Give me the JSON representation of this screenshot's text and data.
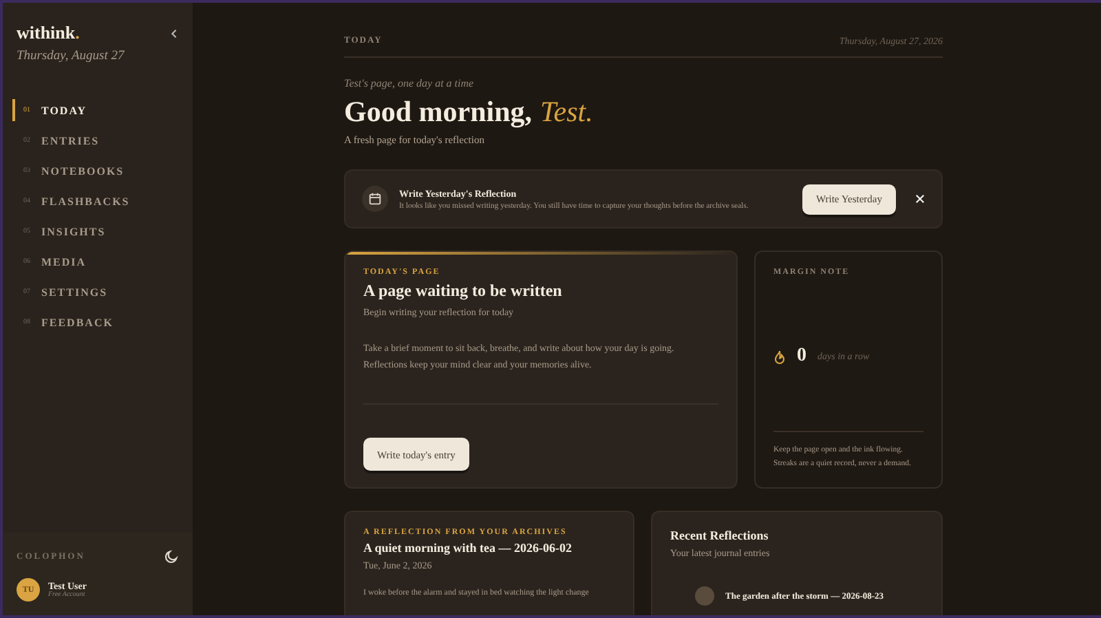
{
  "sidebar": {
    "logo": "withink",
    "logo_dot": ".",
    "date": "Thursday, August 27",
    "nav": [
      {
        "number": "01",
        "label": "TODAY",
        "selected": true
      },
      {
        "number": "02",
        "label": "ENTRIES",
        "selected": false
      },
      {
        "number": "03",
        "label": "NOTEBOOKS",
        "selected": false
      },
      {
        "number": "04",
        "label": "FLASHBACKS",
        "selected": false
      },
      {
        "number": "05",
        "label": "INSIGHTS",
        "selected": false
      },
      {
        "number": "06",
        "label": "MEDIA",
        "selected": false
      },
      {
        "number": "07",
        "label": "SETTINGS",
        "selected": false
      },
      {
        "number": "08",
        "label": "FEEDBACK",
        "selected": false
      }
    ],
    "colophon": "COLOPHON",
    "user": {
      "initials": "TU",
      "name": "Test User",
      "plan": "Free Account"
    }
  },
  "header": {
    "section": "TODAY",
    "date": "Thursday, August 27, 2026"
  },
  "greeting": {
    "eyebrow": "Test's page, one day at a time",
    "hello": "Good morning,",
    "name": "Test.",
    "subtitle": "A fresh page for today's reflection"
  },
  "banner": {
    "title": "Write Yesterday's Reflection",
    "text": "It looks like you missed writing yesterday. You still have time to capture your thoughts before the archive seals.",
    "button": "Write Yesterday"
  },
  "today_card": {
    "eyebrow": "TODAY'S PAGE",
    "title": "A page waiting to be written",
    "subtitle": "Begin writing your reflection for today",
    "body": "Take a brief moment to sit back, breathe, and write about how your day is going. Reflections keep your mind clear and your memories alive.",
    "button": "Write today's entry"
  },
  "margin_note": {
    "label": "MARGIN NOTE",
    "streak": "0",
    "streak_label": "days in a row",
    "note": "Keep the page open and the ink flowing. Streaks are a quiet record, never a demand."
  },
  "archive_card": {
    "eyebrow": "A REFLECTION FROM YOUR ARCHIVES",
    "title": "A quiet morning with tea — 2026-06-02",
    "date": "Tue, June 2, 2026",
    "excerpt": "I woke before the alarm and stayed in bed watching the light change"
  },
  "recent": {
    "title": "Recent Reflections",
    "subtitle": "Your latest journal entries",
    "entries": [
      {
        "title": "The garden after the storm — 2026-08-23"
      }
    ]
  }
}
